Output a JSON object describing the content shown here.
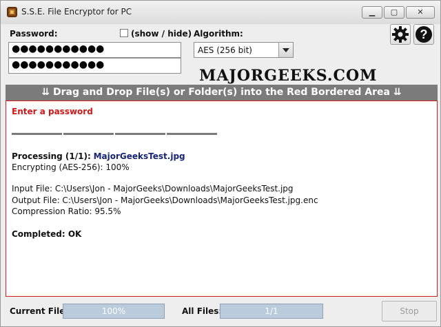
{
  "window": {
    "title": "S.S.E. File Encryptor for PC",
    "controls": [
      "minimize",
      "maximize",
      "close"
    ]
  },
  "password": {
    "label": "Password:",
    "value": "●●●●●●●●●●●",
    "confirm_value": "●●●●●●●●●●●",
    "show_hide_label": "(show / hide)",
    "show_hide_checked": false
  },
  "algorithm": {
    "label": "Algorithm:",
    "selected": "AES (256 bit)"
  },
  "toolbar_icons": [
    "settings-icon",
    "help-icon"
  ],
  "watermark": "MAJORGEEKS.COM",
  "drop_banner": "⇊ Drag and Drop File(s) or Folder(s) into the Red Bordered Area ⇊",
  "log": {
    "prompt": "Enter a password",
    "processing_label": "Processing (1/1):",
    "processing_file": "MajorGeeksTest.jpg",
    "encrypting": "Encrypting (AES-256): 100%",
    "input_file": "Input File: C:\\Users\\Jon - MajorGeeks\\Downloads\\MajorGeeksTest.jpg",
    "output_file": "Output File: C:\\Users\\Jon - MajorGeeks\\Downloads\\MajorGeeksTest.jpg.enc",
    "compression": "Compression Ratio: 95.5%",
    "completed": "Completed: OK"
  },
  "footer": {
    "current_file_label": "Current File:",
    "current_file_progress": "100%",
    "all_files_label": "All Files:",
    "all_files_progress": "1/1",
    "stop_label": "Stop"
  },
  "colors": {
    "banner": "#7b7b7b",
    "drop_border": "#d11c1c",
    "prompt_red": "#d21717",
    "file_blue": "#18247a",
    "progress_fill": "#b9cbdc"
  }
}
